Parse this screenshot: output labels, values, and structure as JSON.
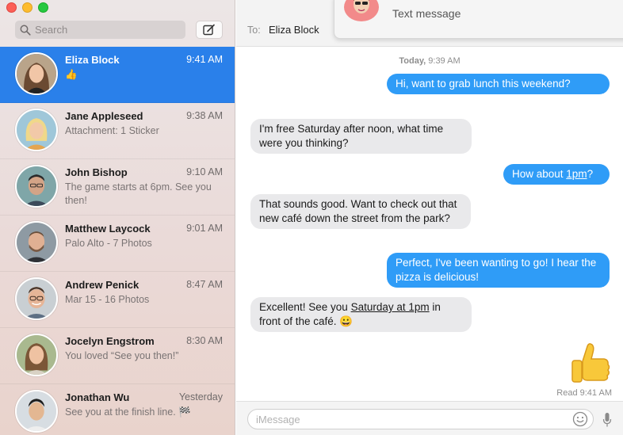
{
  "search": {
    "placeholder": "Search"
  },
  "conversations": [
    {
      "name": "Eliza Block",
      "time": "9:41 AM",
      "preview": "👍"
    },
    {
      "name": "Jane Appleseed",
      "time": "9:38 AM",
      "preview": "Attachment: 1 Sticker"
    },
    {
      "name": "John Bishop",
      "time": "9:10 AM",
      "preview": "The game starts at 6pm. See you then!"
    },
    {
      "name": "Matthew Laycock",
      "time": "9:01 AM",
      "preview": "Palo Alto - 7 Photos"
    },
    {
      "name": "Andrew Penick",
      "time": "8:47 AM",
      "preview": "Mar 15 - 16 Photos"
    },
    {
      "name": "Jocelyn Engstrom",
      "time": "8:30 AM",
      "preview": "You loved “See you then!”"
    },
    {
      "name": "Jonathan Wu",
      "time": "Yesterday",
      "preview": "See you at the finish line. 🏁"
    }
  ],
  "header": {
    "to_label": "To:",
    "recipient": "Eliza Block"
  },
  "notification": {
    "text": "Text message"
  },
  "chat": {
    "timestamp_day": "Today,",
    "timestamp_time": "9:39 AM",
    "messages": [
      {
        "dir": "out",
        "text": "Hi, want to grab lunch this weekend?"
      },
      {
        "dir": "in",
        "text": "I'm free Saturday after noon, what time were you thinking?"
      },
      {
        "dir": "out",
        "text_before": "How about ",
        "text_link": "1pm",
        "text_after": "?"
      },
      {
        "dir": "in",
        "text": "That sounds good. Want to check out that new café down the street from the park?"
      },
      {
        "dir": "out",
        "text": "Perfect, I've been wanting to go! I hear the pizza is delicious!"
      },
      {
        "dir": "in",
        "text_before": "Excellent! See you ",
        "text_link": "Saturday at 1pm",
        "text_after": " in front of the café. 😀"
      },
      {
        "dir": "out",
        "emoji": "👍"
      }
    ],
    "read_receipt": "Read 9:41 AM"
  },
  "input": {
    "placeholder": "iMessage"
  },
  "colors": {
    "accent": "#2a80ea",
    "bubble_out": "#2f9cf7",
    "bubble_in": "#e9e9eb"
  }
}
